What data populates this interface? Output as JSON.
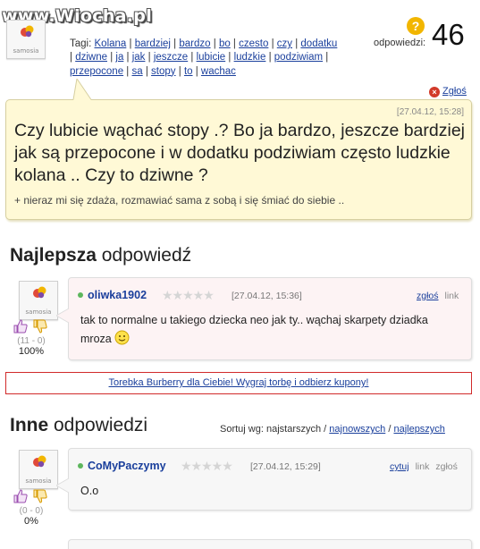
{
  "watermark": "www.Wiocha.pl",
  "avatar_label": "samosia",
  "question": {
    "tags_label": "Tagi:",
    "tags": [
      "Kolana",
      "bardziej",
      "bardzo",
      "bo",
      "czesto",
      "czy",
      "dodatku",
      "dziwne",
      "ja",
      "jak",
      "jeszcze",
      "lubicie",
      "ludzkie",
      "podziwiam",
      "przepocone",
      "sa",
      "stopy",
      "to",
      "wachac"
    ],
    "answers_label": "odpowiedzi:",
    "answers_count": "46",
    "report_label": "Zgłoś",
    "date": "[27.04.12, 15:28]",
    "text": "Czy lubicie wąchać stopy .? Bo ja bardzo, jeszcze bardziej jak są przepocone i w dodatku podziwiam często ludzkie kolana .. Czy to dziwne ?",
    "extra": "+ nieraz mi się zdaża, rozmawiać sama z sobą i się śmiać do siebie .."
  },
  "best": {
    "heading_bold": "Najlepsza",
    "heading_rest": " odpowiedź",
    "user": "oliwka1902",
    "date": "[27.04.12, 15:36]",
    "report": "zgłoś",
    "link": "link",
    "text": "tak to normalne u takiego dziecka neo jak ty.. wąchaj skarpety dziadka mroza",
    "votes": "(11 - 0)",
    "percent": "100%"
  },
  "promo": {
    "text": "Torebka Burberry dla Ciebie! Wygraj torbę i odbierz kupony!"
  },
  "others": {
    "heading_bold": "Inne",
    "heading_rest": " odpowiedzi",
    "sort_label": "Sortuj wg: najstarszych /",
    "sort_newest": "najnowszych",
    "sort_sep": "/",
    "sort_best": "najlepszych",
    "answers": [
      {
        "user": "CoMyPaczymy",
        "date": "[27.04.12, 15:29]",
        "quote": "cytuj",
        "link": "link",
        "report": "zgłoś",
        "text": "O.o",
        "votes": "(0 - 0)",
        "percent": "0%"
      }
    ]
  },
  "colors": {
    "link": "#1a3f9c",
    "question_bg": "#fff9d6",
    "best_bg": "#fdf3f4",
    "promo_border": "#d12a2a"
  }
}
